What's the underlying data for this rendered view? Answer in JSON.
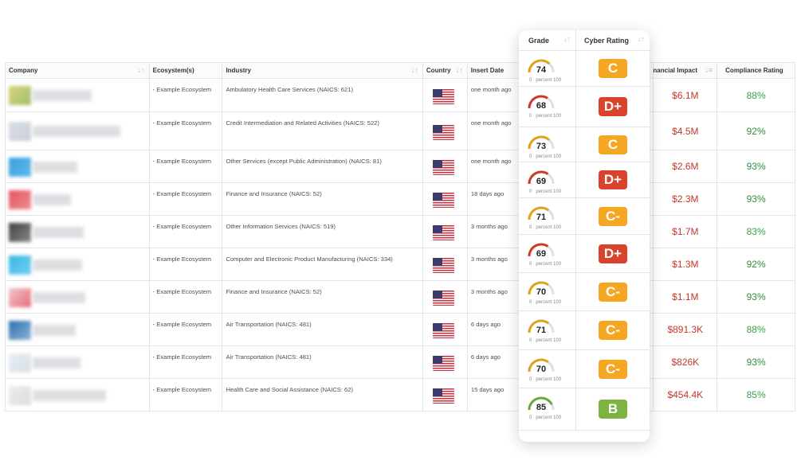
{
  "columns": {
    "company": "Company",
    "ecosystem": "Ecosystem(s)",
    "industry": "Industry",
    "country": "Country",
    "insert_date": "Insert Date",
    "financial_impact": "Financial Impact",
    "compliance_rating": "Compliance Rating",
    "grade": "Grade",
    "cyber_rating": "Cyber Rating"
  },
  "sort_glyph": "↓↑",
  "sort_glyph_active": "↓≡",
  "gauge_caption_min": "0",
  "gauge_caption_max": "percent 100",
  "colors": {
    "gauge_orange": "#e0a21a",
    "gauge_red": "#cf3a24",
    "gauge_green": "#6aa83a",
    "financial": "#c0392b",
    "compliance": "#3aa24b"
  },
  "rows": [
    {
      "ecosystem": "- Example Ecosystem",
      "industry": "Ambulatory Health Care Services (NAICS: 621)",
      "country": "us-flag",
      "insert_date": "one month ago",
      "financial_impact": "$6.1M",
      "compliance": "88%"
    },
    {
      "ecosystem": "- Example Ecosystem",
      "industry": "Credit Intermediation and Related Activities (NAICS: 522)",
      "country": "us-flag",
      "insert_date": "one month ago",
      "financial_impact": "$4.5M",
      "compliance": "92%"
    },
    {
      "ecosystem": "- Example Ecosystem",
      "industry": "Other Services (except Public Administration) (NAICS: 81)",
      "country": "us-flag",
      "insert_date": "one month ago",
      "financial_impact": "$2.6M",
      "compliance": "93%"
    },
    {
      "ecosystem": "- Example Ecosystem",
      "industry": "Finance and Insurance (NAICS: 52)",
      "country": "us-flag",
      "insert_date": "18 days ago",
      "financial_impact": "$2.3M",
      "compliance": "93%"
    },
    {
      "ecosystem": "- Example Ecosystem",
      "industry": "Other Information Services (NAICS: 519)",
      "country": "us-flag",
      "insert_date": "3 months ago",
      "financial_impact": "$1.7M",
      "compliance": "83%"
    },
    {
      "ecosystem": "- Example Ecosystem",
      "industry": "Computer and Electronic Product Manufacturing (NAICS: 334)",
      "country": "us-flag",
      "insert_date": "3 months ago",
      "financial_impact": "$1.3M",
      "compliance": "92%"
    },
    {
      "ecosystem": "- Example Ecosystem",
      "industry": "Finance and Insurance (NAICS: 52)",
      "country": "us-flag",
      "insert_date": "3 months ago",
      "financial_impact": "$1.1M",
      "compliance": "93%"
    },
    {
      "ecosystem": "- Example Ecosystem",
      "industry": "Air Transportation (NAICS: 481)",
      "country": "us-flag",
      "insert_date": "6 days ago",
      "financial_impact": "$891.3K",
      "compliance": "88%"
    },
    {
      "ecosystem": "- Example Ecosystem",
      "industry": "Air Transportation (NAICS: 481)",
      "country": "us-flag",
      "insert_date": "6 days ago",
      "financial_impact": "$826K",
      "compliance": "93%"
    },
    {
      "ecosystem": "- Example Ecosystem",
      "industry": "Health Care and Social Assistance (NAICS: 62)",
      "country": "us-flag",
      "insert_date": "15 days ago",
      "financial_impact": "$454.4K",
      "compliance": "85%"
    }
  ],
  "grades": [
    {
      "score": "74",
      "rating": "C",
      "color": "#e0a21a",
      "badge": "orange"
    },
    {
      "score": "68",
      "rating": "D+",
      "color": "#cf3a24",
      "badge": "red"
    },
    {
      "score": "73",
      "rating": "C",
      "color": "#e0a21a",
      "badge": "orange"
    },
    {
      "score": "69",
      "rating": "D+",
      "color": "#cf3a24",
      "badge": "red"
    },
    {
      "score": "71",
      "rating": "C-",
      "color": "#e0a21a",
      "badge": "orange"
    },
    {
      "score": "69",
      "rating": "D+",
      "color": "#cf3a24",
      "badge": "red"
    },
    {
      "score": "70",
      "rating": "C-",
      "color": "#e0a21a",
      "badge": "orange"
    },
    {
      "score": "71",
      "rating": "C-",
      "color": "#e0a21a",
      "badge": "orange"
    },
    {
      "score": "70",
      "rating": "C-",
      "color": "#e0a21a",
      "badge": "orange"
    },
    {
      "score": "85",
      "rating": "B",
      "color": "#6aa83a",
      "badge": "green"
    }
  ]
}
